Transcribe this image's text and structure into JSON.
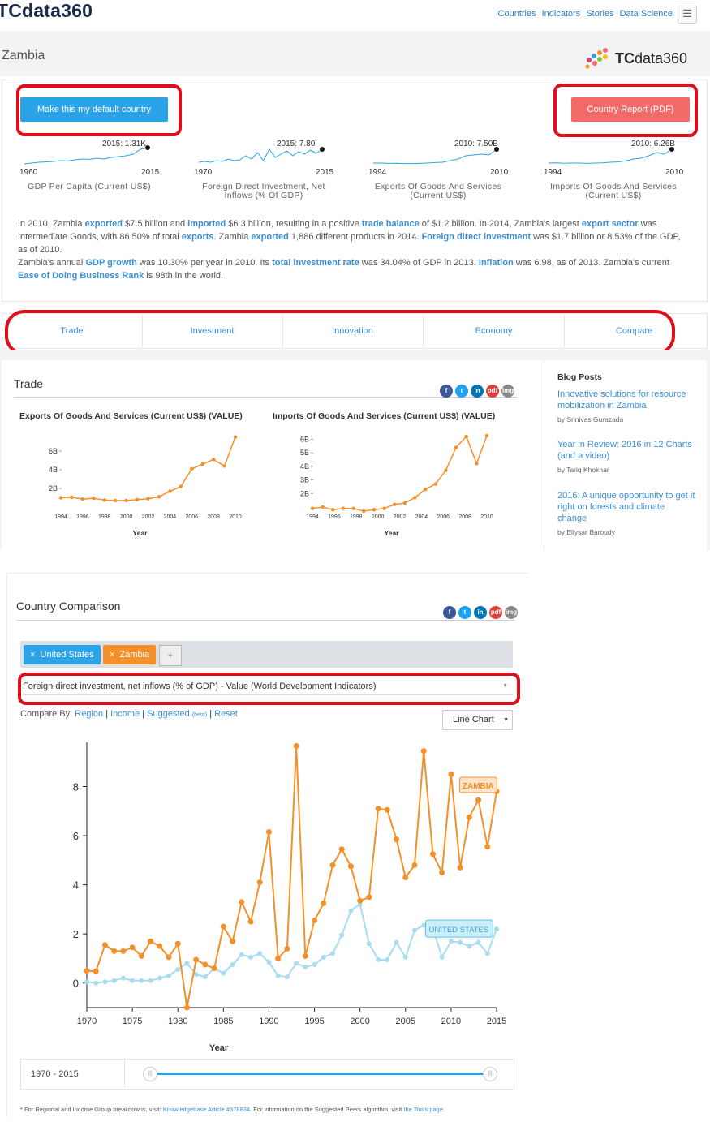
{
  "app": {
    "logo": "TCdata360",
    "brand_prefix": "TC",
    "brand_suffix": "data360"
  },
  "nav": {
    "items": [
      "Countries",
      "Indicators",
      "Stories",
      "Data Science"
    ],
    "menu_icon": "hamburger-icon"
  },
  "country": {
    "name": "Zambia"
  },
  "buttons": {
    "default_country": "Make this my default country",
    "report": "Country Report (PDF)"
  },
  "sparklines": [
    {
      "title": "GDP Per Capita (Current US$)",
      "start": "1960",
      "end": "2015",
      "last": "2015: 1.31K"
    },
    {
      "title": "Foreign Direct Investment, Net Inflows (% Of GDP)",
      "start": "1970",
      "end": "2015",
      "last": "2015: 7.80"
    },
    {
      "title": "Exports Of Goods And Services (Current US$)",
      "start": "1994",
      "end": "2010",
      "last": "2010: 7.50B"
    },
    {
      "title": "Imports Of Goods And Services (Current US$)",
      "start": "1994",
      "end": "2010",
      "last": "2010: 6.26B"
    }
  ],
  "summary": {
    "p1": [
      {
        "t": "In 2010, Zambia "
      },
      {
        "l": "exported"
      },
      {
        "t": " $7.5 billion and "
      },
      {
        "l": "imported"
      },
      {
        "t": " $6.3 billion, resulting in a positive "
      },
      {
        "l": "trade balance"
      },
      {
        "t": " of $1.2 billion. In 2014, Zambia's largest "
      },
      {
        "l": "export sector"
      },
      {
        "t": " was Intermediate Goods, with 86.50% of total "
      },
      {
        "l": "exports"
      },
      {
        "t": ". Zambia "
      },
      {
        "l": "exported"
      },
      {
        "t": " 1,886 different products in 2014. "
      },
      {
        "l": "Foreign direct investment"
      },
      {
        "t": " was $1.7 billion or 8.53% of the GDP, as of 2010."
      }
    ],
    "p2": [
      {
        "t": "Zambia's annual "
      },
      {
        "l": "GDP growth"
      },
      {
        "t": " was 10.30% per year in 2010. Its "
      },
      {
        "l": "total investment rate"
      },
      {
        "t": " was 34.04% of GDP in 2013. "
      },
      {
        "l": "Inflation"
      },
      {
        "t": " was 6.98, as of 2013. Zambia's current "
      },
      {
        "l": "Ease of Doing Business Rank"
      },
      {
        "t": " is 98th in the world."
      }
    ]
  },
  "tabs": [
    "Trade",
    "Investment",
    "Innovation",
    "Economy",
    "Compare"
  ],
  "trade": {
    "title": "Trade",
    "share_icons": [
      "facebook-icon",
      "twitter-icon",
      "linkedin-icon",
      "pdf-icon",
      "image-icon"
    ],
    "share_labels": [
      "f",
      "t",
      "in",
      "pdf",
      "img"
    ]
  },
  "blog": {
    "heading": "Blog Posts",
    "posts": [
      {
        "title": "Innovative solutions for resource mobilization in Zambia",
        "author": "by Srinivas Gurazada"
      },
      {
        "title": "Year in Review: 2016 in 12 Charts (and a video)",
        "author": "by Tariq Khokhar"
      },
      {
        "title": "2016: A unique opportunity to get it right on forests and climate change",
        "author": "by Ellysar Baroudy"
      }
    ]
  },
  "comparison": {
    "title": "Country Comparison",
    "tags": [
      {
        "label": "United States",
        "color": "#2aa3e8"
      },
      {
        "label": "Zambia",
        "color": "#f4902a"
      }
    ],
    "plus": "+",
    "indicator": "Foreign direct investment, net inflows (% of GDP) - Value (World Development Indicators)",
    "compare_by_label": "Compare By:",
    "compare_links": [
      "Region",
      "Income",
      "Suggested",
      "Reset"
    ],
    "suggested_note": "(beta)",
    "chart_type": "Line Chart",
    "range": "1970 - 2015",
    "footnote_a": "* For Regional and Income Group breakdowns, visit: ",
    "footnote_link1": "Knowledgebase Article #378834",
    "footnote_b": ". For information on the Suggested Peers algorithm, visit ",
    "footnote_link2": "the Tools page",
    "footnote_c": "."
  },
  "colors": {
    "orange": "#f4902a",
    "blue": "#a8dcef",
    "accent": "#3a8fd9",
    "red_highlight": "#e00d1a"
  },
  "chart_data": [
    {
      "type": "line",
      "title": "Exports Of Goods And Services (Current US$) (VALUE)",
      "xlabel": "Year",
      "ylabel": "",
      "x": [
        1994,
        1995,
        1996,
        1997,
        1998,
        1999,
        2000,
        2001,
        2002,
        2003,
        2004,
        2005,
        2006,
        2007,
        2008,
        2009,
        2010
      ],
      "series": [
        {
          "values": [
            1.0,
            1.05,
            0.85,
            0.95,
            0.75,
            0.7,
            0.7,
            0.8,
            0.9,
            1.1,
            1.7,
            2.2,
            4.1,
            4.6,
            5.1,
            4.4,
            7.5
          ]
        }
      ],
      "yticks": [
        "2B",
        "4B",
        "6B"
      ],
      "xticks": [
        "1994",
        "1996",
        "1998",
        "2000",
        "2002",
        "2004",
        "2006",
        "2008",
        "2010"
      ],
      "ylim": [
        0,
        8
      ]
    },
    {
      "type": "line",
      "title": "Imports Of Goods And Services (Current US$) (VALUE)",
      "xlabel": "Year",
      "ylabel": "",
      "x": [
        1994,
        1995,
        1996,
        1997,
        1998,
        1999,
        2000,
        2001,
        2002,
        2003,
        2004,
        2005,
        2006,
        2007,
        2008,
        2009,
        2010
      ],
      "series": [
        {
          "values": [
            0.9,
            1.0,
            0.8,
            0.9,
            0.9,
            0.7,
            0.8,
            0.9,
            1.2,
            1.3,
            1.7,
            2.3,
            2.7,
            3.7,
            5.4,
            6.2,
            4.2,
            6.26
          ]
        }
      ],
      "yticks": [
        "2B",
        "3B",
        "4B",
        "5B",
        "6B"
      ],
      "xticks": [
        "1994",
        "1996",
        "1998",
        "2000",
        "2002",
        "2004",
        "2006",
        "2008",
        "2010"
      ],
      "ylim": [
        1,
        6.5
      ]
    },
    {
      "type": "line",
      "title": "",
      "xlabel": "Year",
      "ylabel": "",
      "x": [
        1970,
        1971,
        1972,
        1973,
        1974,
        1975,
        1976,
        1977,
        1978,
        1979,
        1980,
        1981,
        1982,
        1983,
        1984,
        1985,
        1986,
        1987,
        1988,
        1989,
        1990,
        1991,
        1992,
        1993,
        1994,
        1995,
        1996,
        1997,
        1998,
        1999,
        2000,
        2001,
        2002,
        2003,
        2004,
        2005,
        2006,
        2007,
        2008,
        2009,
        2010,
        2011,
        2012,
        2013,
        2014,
        2015
      ],
      "series": [
        {
          "name": "ZAMBIA",
          "color": "#f4902a",
          "values": [
            0.5,
            0.48,
            1.55,
            1.3,
            1.3,
            1.45,
            1.1,
            1.7,
            1.5,
            1.05,
            1.6,
            -1.0,
            0.95,
            0.75,
            0.6,
            2.3,
            1.7,
            3.3,
            2.5,
            4.1,
            6.15,
            1.0,
            1.4,
            9.65,
            1.1,
            2.55,
            3.25,
            4.8,
            5.45,
            4.75,
            3.35,
            3.5,
            7.1,
            7.05,
            5.85,
            4.3,
            4.8,
            9.45,
            5.25,
            4.5,
            8.5,
            4.7,
            6.75,
            7.45,
            5.55,
            7.8
          ]
        },
        {
          "name": "UNITED STATES",
          "color": "#a8dcef",
          "values": [
            0.05,
            0.0,
            0.05,
            0.1,
            0.2,
            0.1,
            0.1,
            0.1,
            0.2,
            0.3,
            0.55,
            0.8,
            0.35,
            0.25,
            0.6,
            0.4,
            0.75,
            1.15,
            1.05,
            1.2,
            0.85,
            0.3,
            0.25,
            0.8,
            0.65,
            0.75,
            1.05,
            1.2,
            1.95,
            2.95,
            3.2,
            1.6,
            0.95,
            0.95,
            1.65,
            1.05,
            2.15,
            2.35,
            2.25,
            1.05,
            1.7,
            1.65,
            1.5,
            1.65,
            1.2,
            2.2
          ]
        }
      ],
      "yticks": [
        "0",
        "2",
        "4",
        "6",
        "8"
      ],
      "xticks": [
        "1970",
        "1975",
        "1980",
        "1985",
        "1990",
        "1995",
        "2000",
        "2005",
        "2010",
        "2015"
      ],
      "ylim": [
        -1,
        9.8
      ]
    }
  ]
}
